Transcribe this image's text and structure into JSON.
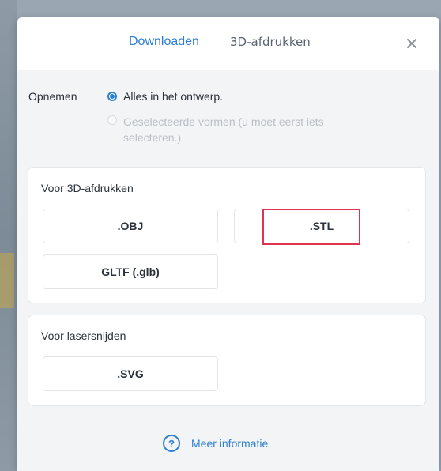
{
  "tabs": [
    {
      "label": "Downloaden",
      "active": true
    },
    {
      "label": "3D-afdrukken",
      "active": false
    }
  ],
  "close_icon": "close-icon",
  "include": {
    "label": "Opnemen",
    "options": [
      {
        "label": "Alles in het ontwerp.",
        "selected": true,
        "enabled": true
      },
      {
        "label": "Geselecteerde vormen (u moet eerst iets selecteren.)",
        "selected": false,
        "enabled": false
      }
    ]
  },
  "sections": {
    "print3d": {
      "title": "Voor 3D-afdrukken",
      "buttons": [
        ".OBJ",
        ".STL",
        "GLTF (.glb)"
      ]
    },
    "laser": {
      "title": "Voor lasersnijden",
      "buttons": [
        ".SVG"
      ]
    }
  },
  "footer": {
    "help_icon": "help-circle-icon",
    "label": "Meer informatie"
  },
  "colors": {
    "accent": "#2c7fd1",
    "highlight": "#e0334f"
  }
}
